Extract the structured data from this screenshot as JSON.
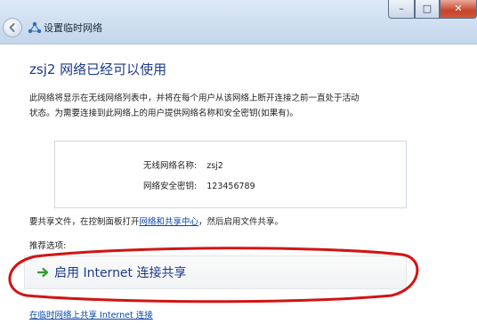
{
  "window": {
    "title": "设置临时网络",
    "controls": {
      "minimize": "–",
      "maximize": "□",
      "close": "✕"
    },
    "icons": {
      "back": "back-arrow-icon",
      "network": "network-icon"
    }
  },
  "main": {
    "heading": "zsj2 网络已经可以使用",
    "description_line1": "此网络将显示在无线网络列表中，并将在每个用户从该网络上断开连接之前一直处于活动",
    "description_line2": "状态。为需要连接到此网络上的用户提供网络名称和安全密钥(如果有)。",
    "network_info": {
      "name_label": "无线网络名称:",
      "name_value": "zsj2",
      "key_label": "网络安全密钥:",
      "key_value": "123456789"
    },
    "share_text_before": "要共享文件，在控制面板打开",
    "share_link": "网络和共享中心",
    "share_text_after": "，然后启用文件共享。",
    "recommended_label": "推荐选项:",
    "recommended_option": "启用 Internet 连接共享",
    "bottom_link": "在临时网络上共享 Internet 连接"
  },
  "colors": {
    "heading": "#1e3a8a",
    "link": "#0645ad",
    "highlight_ellipse": "#d21414",
    "option_arrow": "#2f9e2f"
  }
}
